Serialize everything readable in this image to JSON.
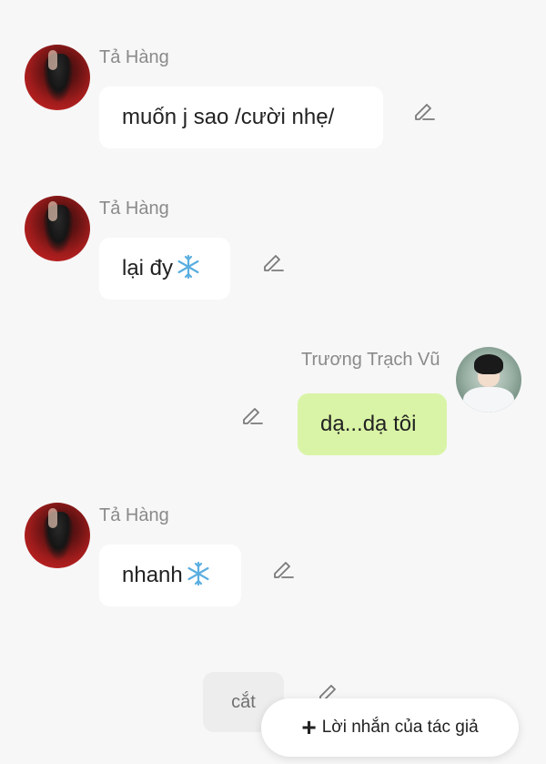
{
  "messages": [
    {
      "sender": "Tả Hàng",
      "text": "muốn j sao /cười nhẹ/"
    },
    {
      "sender": "Tả Hàng",
      "text": "lại đy",
      "emoji": "snowflake-icon"
    },
    {
      "sender": "Trương Trạch Vũ",
      "text": "dạ...dạ tôi"
    },
    {
      "sender": "Tả Hàng",
      "text": "nhanh",
      "emoji": "snowflake-icon"
    }
  ],
  "divider": {
    "label": "cắt"
  },
  "author_note": {
    "label": "Lời nhắn của tác giả",
    "icon": "plus-icon"
  },
  "colors": {
    "background": "#f7f7f7",
    "bubble_left": "#ffffff",
    "bubble_right": "#d9f4a6",
    "name": "#8a8a8a"
  }
}
